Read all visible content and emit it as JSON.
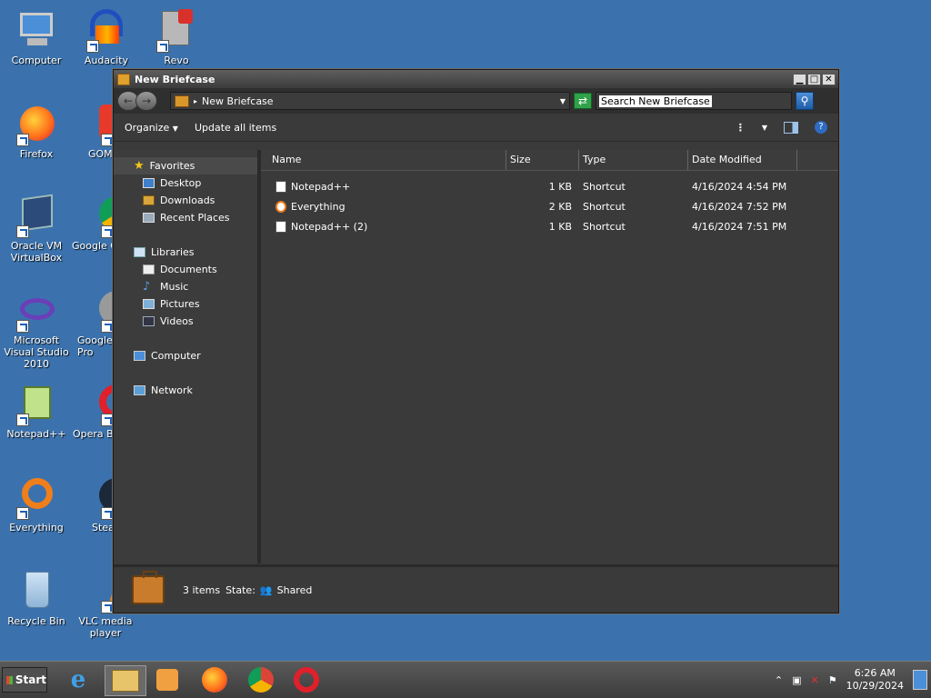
{
  "desktop": {
    "icons": [
      {
        "label": "Computer"
      },
      {
        "label": "Audacity"
      },
      {
        "label": "Revo"
      },
      {
        "label": "Firefox"
      },
      {
        "label": "GOM Pl"
      },
      {
        "label": "Oracle VM VirtualBox"
      },
      {
        "label": "Google C"
      },
      {
        "label": "Microsoft Visual Studio 2010"
      },
      {
        "label": "Google Pro"
      },
      {
        "label": "Notepad++"
      },
      {
        "label": "Opera Br"
      },
      {
        "label": "Everything"
      },
      {
        "label": "Stea"
      },
      {
        "label": "Recycle Bin"
      },
      {
        "label": "VLC media player"
      }
    ]
  },
  "window": {
    "title": "New Briefcase",
    "address": "New Briefcase",
    "search_placeholder": "Search New Briefcase",
    "toolbar": {
      "organize": "Organize",
      "update_all": "Update all items"
    },
    "nav": {
      "favorites": "Favorites",
      "desktop": "Desktop",
      "downloads": "Downloads",
      "recent": "Recent Places",
      "libraries": "Libraries",
      "documents": "Documents",
      "music": "Music",
      "pictures": "Pictures",
      "videos": "Videos",
      "computer": "Computer",
      "network": "Network"
    },
    "columns": {
      "name": "Name",
      "size": "Size",
      "type": "Type",
      "date": "Date Modified"
    },
    "files": [
      {
        "name": "Notepad++",
        "size": "1 KB",
        "type": "Shortcut",
        "date": "4/16/2024 4:54 PM"
      },
      {
        "name": "Everything",
        "size": "2 KB",
        "type": "Shortcut",
        "date": "4/16/2024 7:52 PM"
      },
      {
        "name": "Notepad++ (2)",
        "size": "1 KB",
        "type": "Shortcut",
        "date": "4/16/2024 7:51 PM"
      }
    ],
    "details": {
      "count": "3 items",
      "state_label": "State:",
      "state_value": "Shared"
    }
  },
  "taskbar": {
    "start": "Start",
    "time": "6:26 AM",
    "date": "10/29/2024"
  }
}
